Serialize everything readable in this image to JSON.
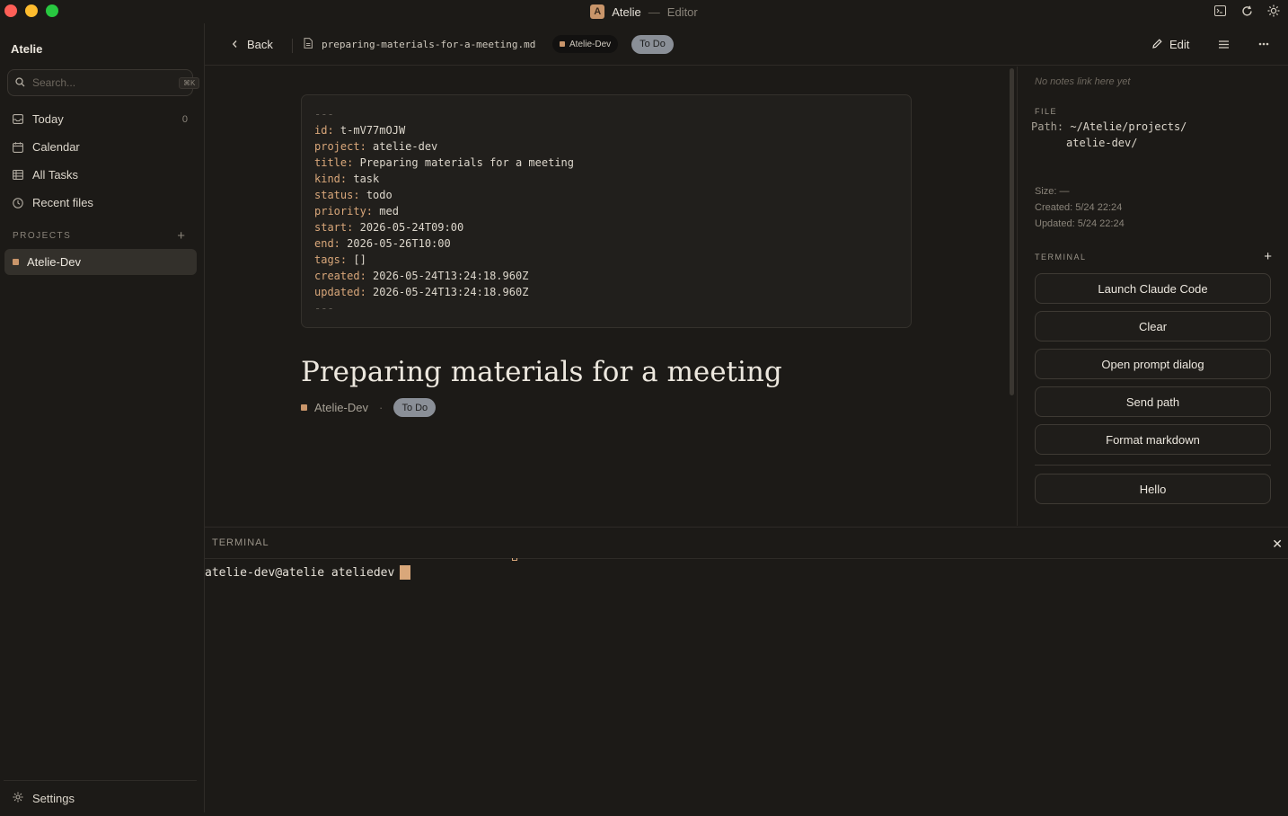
{
  "window": {
    "app_name": "Atelie",
    "separator": "—",
    "subtitle": "Editor",
    "logo_letter": "A"
  },
  "sidebar": {
    "title": "Atelie",
    "search": {
      "placeholder": "Search...",
      "shortcut": "⌘K"
    },
    "nav": [
      {
        "label": "Today",
        "count": "0",
        "icon": "inbox-icon"
      },
      {
        "label": "Calendar",
        "icon": "calendar-icon"
      },
      {
        "label": "All Tasks",
        "icon": "table-icon"
      },
      {
        "label": "Recent files",
        "icon": "clock-icon"
      }
    ],
    "projects_heading": "PROJECTS",
    "projects_add": "+",
    "projects": [
      {
        "label": "Atelie-Dev",
        "color": "#c9956a"
      }
    ],
    "settings_label": "Settings"
  },
  "header": {
    "back_label": "Back",
    "filename": "preparing-materials-for-a-meeting.md",
    "project_chip": "Atelie-Dev",
    "status_chip": "To Do",
    "edit_label": "Edit"
  },
  "frontmatter": {
    "open": "---",
    "close": "---",
    "fields": [
      {
        "key": "id:",
        "value": "t-mV77mOJW"
      },
      {
        "key": "project:",
        "value": "atelie-dev"
      },
      {
        "key": "title:",
        "value": "Preparing materials for a meeting"
      },
      {
        "key": "kind:",
        "value": "task"
      },
      {
        "key": "status:",
        "value": "todo"
      },
      {
        "key": "priority:",
        "value": "med"
      },
      {
        "key": "start:",
        "value": "2026-05-24T09:00"
      },
      {
        "key": "end:",
        "value": "2026-05-26T10:00"
      },
      {
        "key": "tags:",
        "value": "[]"
      },
      {
        "key": "created:",
        "value": "2026-05-24T13:24:18.960Z"
      },
      {
        "key": "updated:",
        "value": "2026-05-24T13:24:18.960Z"
      }
    ]
  },
  "document": {
    "title": "Preparing materials for a meeting",
    "project": "Atelie-Dev",
    "meta_sep": "·",
    "status": "To Do"
  },
  "right_panel": {
    "backlinks_empty": "No notes link here yet",
    "file_heading": "FILE",
    "path_key": "Path:",
    "path_line1": "~/Atelie/projects/",
    "path_line2": "atelie-dev/",
    "size": "Size: —",
    "created": "Created: 5/24 22:24",
    "updated": "Updated: 5/24 22:24",
    "terminal_heading": "TERMINAL",
    "terminal_add": "+",
    "buttons": [
      "Launch Claude Code",
      "Clear",
      "Open prompt dialog",
      "Send path",
      "Format markdown"
    ],
    "extra_button": "Hello"
  },
  "terminal": {
    "heading": "TERMINAL",
    "close": "✕",
    "prompt": "atelie-dev@atelie ateliedev"
  },
  "colors": {
    "background": "#1c1a17",
    "accent": "#c9956a",
    "status_todo": "#8a8f97"
  }
}
